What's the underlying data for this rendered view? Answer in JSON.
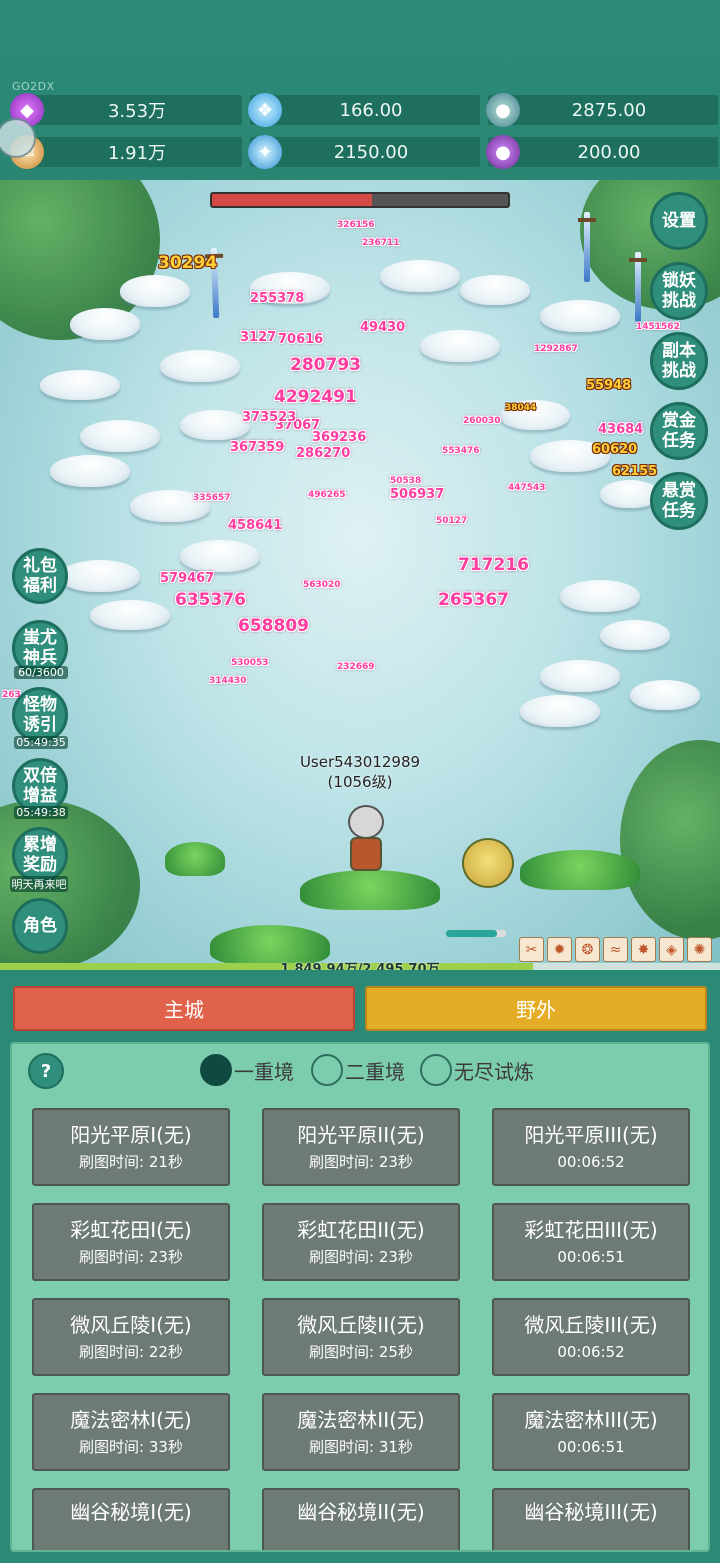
{
  "top": {
    "tag": "GO2DX",
    "resources": [
      {
        "icon": "purple-gem-icon",
        "value": "3.53万"
      },
      {
        "icon": "blue-crystal-icon",
        "value": "166.00"
      },
      {
        "icon": "green-ore-icon",
        "value": "2875.00"
      },
      {
        "icon": "scroll-icon",
        "value": "1.91万"
      },
      {
        "icon": "ice-crystal-icon",
        "value": "2150.00"
      },
      {
        "icon": "purple-fruit-icon",
        "value": "200.00"
      }
    ]
  },
  "battle": {
    "boss_hp_fraction": 0.54,
    "right_buttons": [
      "设置",
      "锁妖挑战",
      "副本挑战",
      "赏金任务",
      "悬赏任务"
    ],
    "left_buttons": [
      {
        "label": "礼包福利",
        "sub": ""
      },
      {
        "label": "蚩尤神兵",
        "sub": "60/3600"
      },
      {
        "label": "怪物诱引",
        "sub": "05:49:35"
      },
      {
        "label": "双倍增益",
        "sub": "05:49:38"
      },
      {
        "label": "累增奖励",
        "sub": "明天再来吧"
      },
      {
        "label": "角色",
        "sub": ""
      }
    ],
    "player_name": "User543012989",
    "player_level": "(1056级)",
    "exp_text": "1,849.94万/2,495.70万",
    "exp_fraction": 0.74,
    "damage_numbers": [
      "30294",
      "255378",
      "3127",
      "70616",
      "280793",
      "4292491",
      "37067",
      "369236",
      "367359",
      "286270",
      "373523",
      "49430",
      "55948",
      "43684",
      "60620",
      "62155",
      "717216",
      "265367",
      "579467",
      "635376",
      "658809",
      "506937",
      "458641",
      "496265",
      "563020",
      "553476",
      "326156",
      "236711",
      "260030",
      "50538",
      "50127",
      "447543",
      "335657",
      "38044",
      "1292867",
      "1451562",
      "530053",
      "314430",
      "232669",
      "263"
    ]
  },
  "panel": {
    "tabs": {
      "main_city": "主城",
      "wild": "野外"
    },
    "help": "?",
    "realms": [
      {
        "label": "一重境",
        "selected": true
      },
      {
        "label": "二重境",
        "selected": false
      },
      {
        "label": "无尽试炼",
        "selected": false
      }
    ],
    "maps": [
      {
        "name": "阳光平原I(无)",
        "info": "刷图时间: 21秒"
      },
      {
        "name": "阳光平原II(无)",
        "info": "刷图时间: 23秒"
      },
      {
        "name": "阳光平原III(无)",
        "info": "00:06:52"
      },
      {
        "name": "彩虹花田I(无)",
        "info": "刷图时间: 23秒"
      },
      {
        "name": "彩虹花田II(无)",
        "info": "刷图时间: 23秒"
      },
      {
        "name": "彩虹花田III(无)",
        "info": "00:06:51"
      },
      {
        "name": "微风丘陵I(无)",
        "info": "刷图时间: 22秒"
      },
      {
        "name": "微风丘陵II(无)",
        "info": "刷图时间: 25秒"
      },
      {
        "name": "微风丘陵III(无)",
        "info": "00:06:52"
      },
      {
        "name": "魔法密林I(无)",
        "info": "刷图时间: 33秒"
      },
      {
        "name": "魔法密林II(无)",
        "info": "刷图时间: 31秒"
      },
      {
        "name": "魔法密林III(无)",
        "info": "00:06:51"
      },
      {
        "name": "幽谷秘境I(无)",
        "info": ""
      },
      {
        "name": "幽谷秘境II(无)",
        "info": ""
      },
      {
        "name": "幽谷秘境III(无)",
        "info": ""
      }
    ]
  }
}
